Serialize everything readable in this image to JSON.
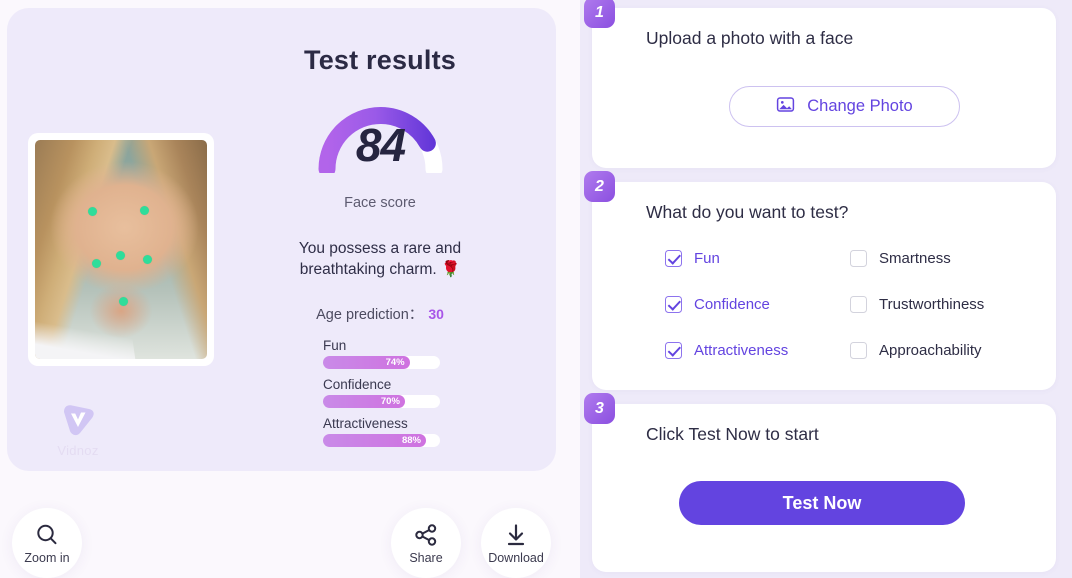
{
  "result": {
    "title": "Test results",
    "score": "84",
    "score_label": "Face score",
    "charm_line1": "You possess a rare and",
    "charm_line2": "breathtaking charm. 🌹",
    "age_label": "Age prediction：",
    "age_value": "30",
    "gauge_percent": 84,
    "metrics": [
      {
        "label": "Fun",
        "percent": 74,
        "percent_text": "74%"
      },
      {
        "label": "Confidence",
        "percent": 70,
        "percent_text": "70%"
      },
      {
        "label": "Attractiveness",
        "percent": 88,
        "percent_text": "88%"
      }
    ],
    "watermark": "Vidnoz"
  },
  "actions": [
    {
      "icon": "magnifier-icon",
      "label": "Zoom in"
    },
    {
      "icon": "share-icon",
      "label": "Share"
    },
    {
      "icon": "download-icon",
      "label": "Download"
    }
  ],
  "steps": [
    {
      "number": "1",
      "title": "Upload a photo with a face",
      "change_photo_label": "Change Photo",
      "change_photo_icon": "image-icon"
    },
    {
      "number": "2",
      "title": "What do you want to test?",
      "options": [
        {
          "label": "Fun",
          "checked": true
        },
        {
          "label": "Smartness",
          "checked": false
        },
        {
          "label": "Confidence",
          "checked": true
        },
        {
          "label": "Trustworthiness",
          "checked": false
        },
        {
          "label": "Attractiveness",
          "checked": true
        },
        {
          "label": "Approachability",
          "checked": false
        }
      ]
    },
    {
      "number": "3",
      "title": "Click Test Now to start",
      "button_label": "Test Now"
    }
  ],
  "colors": {
    "accent": "#6344e0",
    "badge_purple": "#8b4fe0",
    "bar_fill": "#cf72e0",
    "landmark_green": "#2fdd9a",
    "panel_bg": "#eeeaf9",
    "card_bg": "#eeeafa"
  }
}
